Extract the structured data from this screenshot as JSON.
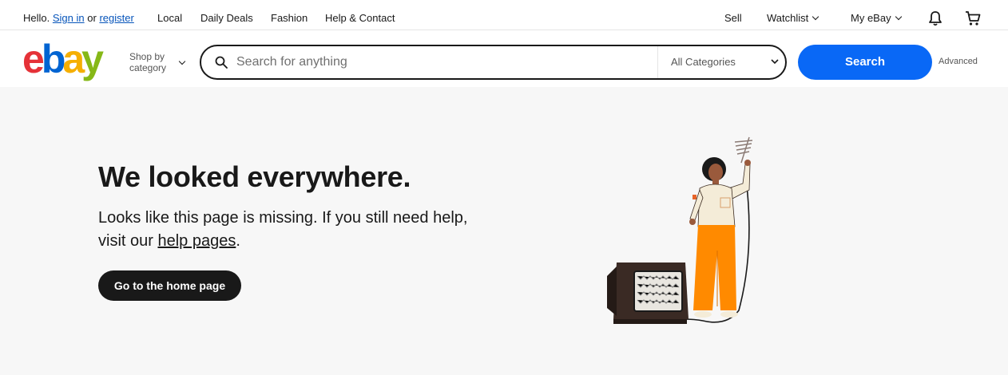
{
  "topbar": {
    "hello": "Hello.",
    "sign_in": "Sign in",
    "or": "or",
    "register": "register",
    "nav": [
      "Local",
      "Daily Deals",
      "Fashion",
      "Help & Contact"
    ],
    "sell": "Sell",
    "watchlist": "Watchlist",
    "my_ebay": "My eBay"
  },
  "header": {
    "logo": {
      "e": "e",
      "b": "b",
      "a": "a",
      "y": "y"
    },
    "shop_by_line1": "Shop by",
    "shop_by_line2": "category",
    "search_placeholder": "Search for anything",
    "category": "All Categories",
    "search_button": "Search",
    "advanced": "Advanced"
  },
  "main": {
    "headline": "We looked everywhere.",
    "desc_part1": "Looks like this page is missing. If you still need help,",
    "desc_part2": "visit our",
    "desc_link": "help pages",
    "desc_end": ".",
    "home_button": "Go to the home page"
  },
  "colors": {
    "logo_e": "#e53238",
    "logo_b": "#0064d2",
    "logo_a": "#f5af02",
    "logo_y": "#86b817",
    "search_button": "#0968f6",
    "main_bg": "#f7f7f7"
  },
  "icons": [
    "search-icon",
    "bell-icon",
    "cart-icon",
    "chevron-down-icon"
  ],
  "illustration": "person-holding-antenna-with-tv-illustration"
}
